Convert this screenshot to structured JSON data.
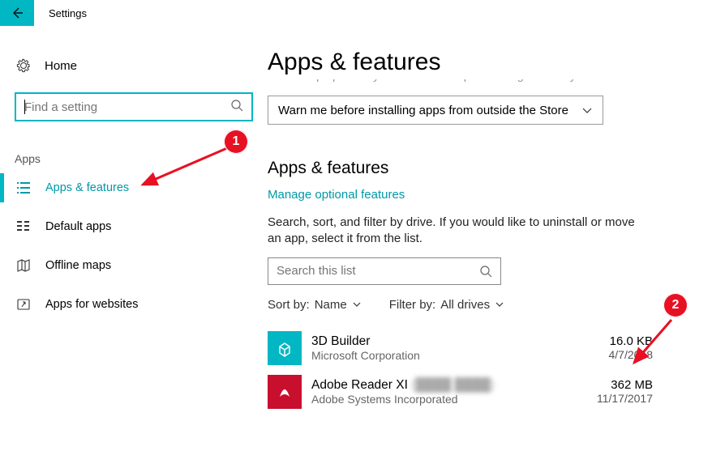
{
  "titlebar": {
    "title": "Settings"
  },
  "sidebar": {
    "home": "Home",
    "search_placeholder": "Find a setting",
    "section": "Apps",
    "items": [
      {
        "label": "Apps & features",
        "icon": "list-icon",
        "active": true
      },
      {
        "label": "Default apps",
        "icon": "defaults-icon",
        "active": false
      },
      {
        "label": "Offline maps",
        "icon": "map-icon",
        "active": false
      },
      {
        "label": "Apps for websites",
        "icon": "link-icon",
        "active": false
      }
    ]
  },
  "content": {
    "heading_main": "Apps & features",
    "clipped_line": "Store helps protect your PC and keep it running smoothly.",
    "warn_select": "Warn me before installing apps from outside the Store",
    "heading_sub": "Apps & features",
    "manage_link": "Manage optional features",
    "description": "Search, sort, and filter by drive. If you would like to uninstall or move an app, select it from the list.",
    "list_search_placeholder": "Search this list",
    "sort_label": "Sort by:",
    "sort_value": "Name",
    "filter_label": "Filter by:",
    "filter_value": "All drives",
    "apps": [
      {
        "name": "3D Builder",
        "publisher": "Microsoft Corporation",
        "size": "16.0 KB",
        "date": "4/7/2018",
        "icon": "3d"
      },
      {
        "name": "Adobe Reader XI",
        "name_blurred": "(████ ████)",
        "publisher": "Adobe Systems Incorporated",
        "size": "362 MB",
        "date": "11/17/2017",
        "icon": "pdf"
      }
    ]
  },
  "annotations": {
    "badge1": "1",
    "badge2": "2"
  }
}
